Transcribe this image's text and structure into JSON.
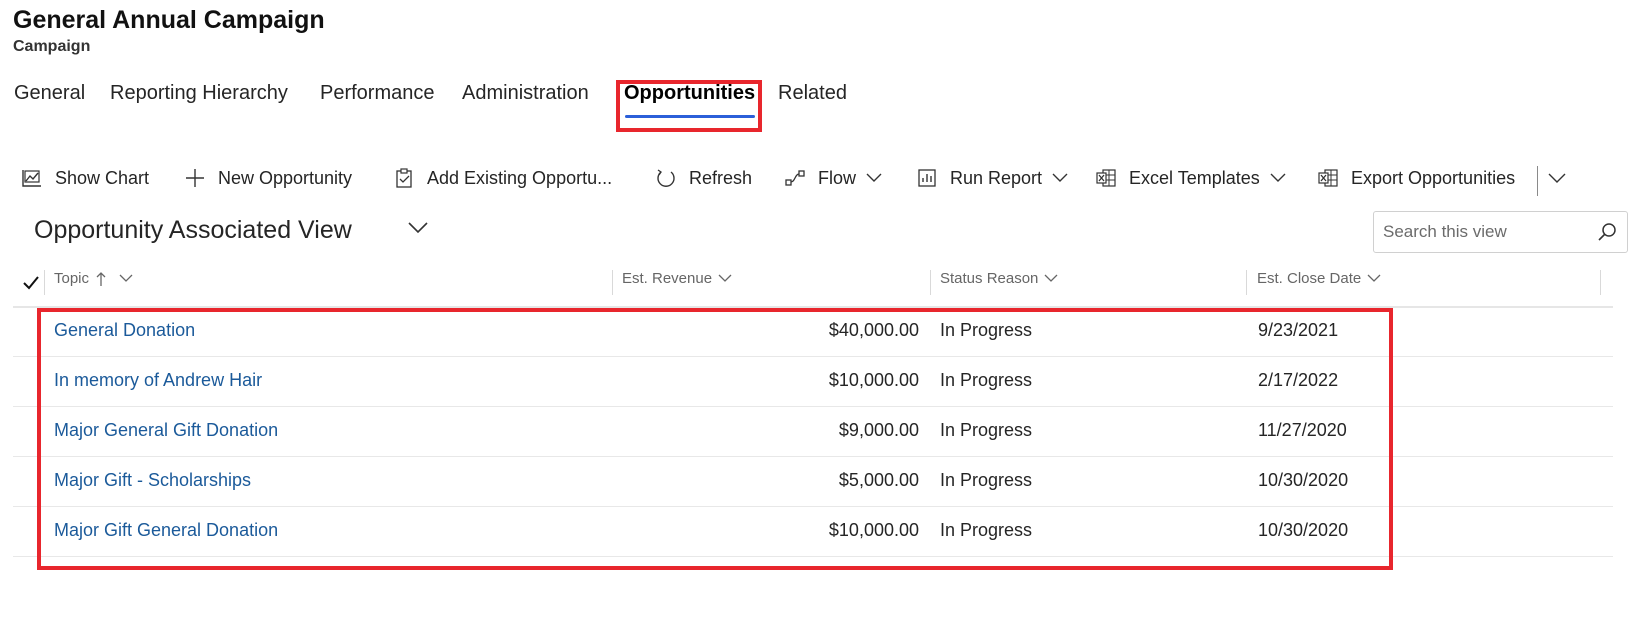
{
  "header": {
    "title": "General Annual Campaign",
    "subtitle": "Campaign"
  },
  "tabs": [
    {
      "label": "General"
    },
    {
      "label": "Reporting Hierarchy"
    },
    {
      "label": "Performance"
    },
    {
      "label": "Administration"
    },
    {
      "label": "Opportunities",
      "active": true
    },
    {
      "label": "Related"
    }
  ],
  "commands": {
    "show_chart": "Show Chart",
    "new_opportunity": "New Opportunity",
    "add_existing": "Add Existing Opportu...",
    "refresh": "Refresh",
    "flow": "Flow",
    "run_report": "Run Report",
    "excel_templates": "Excel Templates",
    "export": "Export Opportunities"
  },
  "view": {
    "title": "Opportunity Associated View",
    "search_placeholder": "Search this view"
  },
  "grid": {
    "columns": [
      "Topic",
      "Est. Revenue",
      "Status Reason",
      "Est. Close Date"
    ],
    "rows": [
      {
        "topic": "General Donation",
        "revenue": "$40,000.00",
        "status": "In Progress",
        "close_date": "9/23/2021"
      },
      {
        "topic": "In memory of Andrew Hair",
        "revenue": "$10,000.00",
        "status": "In Progress",
        "close_date": "2/17/2022"
      },
      {
        "topic": "Major General Gift Donation",
        "revenue": "$9,000.00",
        "status": "In Progress",
        "close_date": "11/27/2020"
      },
      {
        "topic": "Major Gift - Scholarships",
        "revenue": "$5,000.00",
        "status": "In Progress",
        "close_date": "10/30/2020"
      },
      {
        "topic": "Major Gift General Donation",
        "revenue": "$10,000.00",
        "status": "In Progress",
        "close_date": "10/30/2020"
      }
    ]
  },
  "colors": {
    "highlight": "#e8262d",
    "tab_underline": "#2b5fd9",
    "link": "#1b5a9a"
  }
}
